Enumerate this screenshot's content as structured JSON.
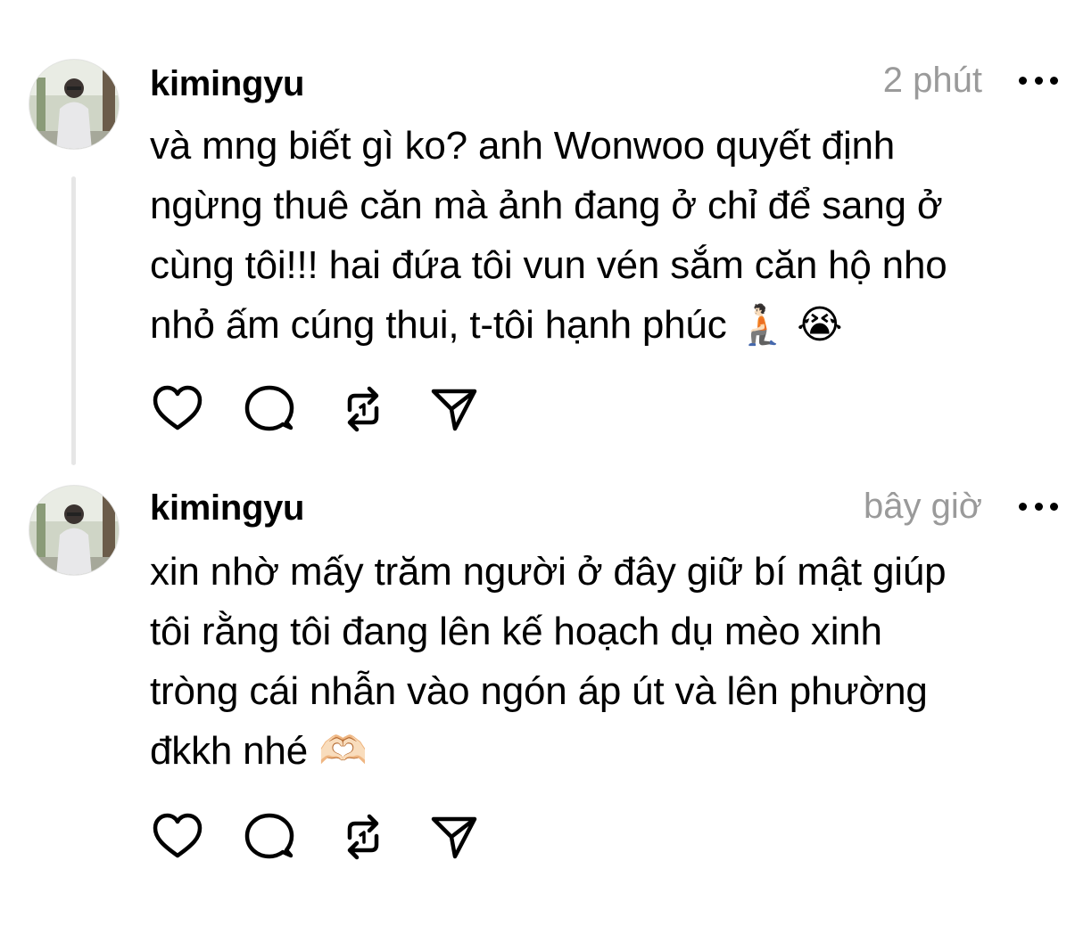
{
  "posts": [
    {
      "username": "kimingyu",
      "time": "2 phút",
      "text": "và mng biết gì ko? anh Wonwoo quyết định\nngừng thuê căn mà ảnh đang ở chỉ để sang ở\ncùng tôi!!! hai đứa tôi vun vén sắm căn hộ nho\nnhỏ ấm cúng thui, t-tôi hạnh phúc 🧎🏻 😭",
      "icons": [
        "heart-icon",
        "comment-icon",
        "repost-icon",
        "share-icon"
      ]
    },
    {
      "username": "kimingyu",
      "time": "bây giờ",
      "text": "xin nhờ mấy trăm người ở đây giữ bí mật giúp\ntôi rằng tôi đang lên kế hoạch dụ mèo xinh\ntròng cái nhẫn vào ngón áp út và lên phường\nđkkh nhé 🫶🏻",
      "icons": [
        "heart-icon",
        "comment-icon",
        "repost-icon",
        "share-icon"
      ]
    }
  ],
  "colors": {
    "text": "#000000",
    "muted": "#9a9a9a",
    "thread_line": "#e6e6e6",
    "background": "#ffffff"
  }
}
